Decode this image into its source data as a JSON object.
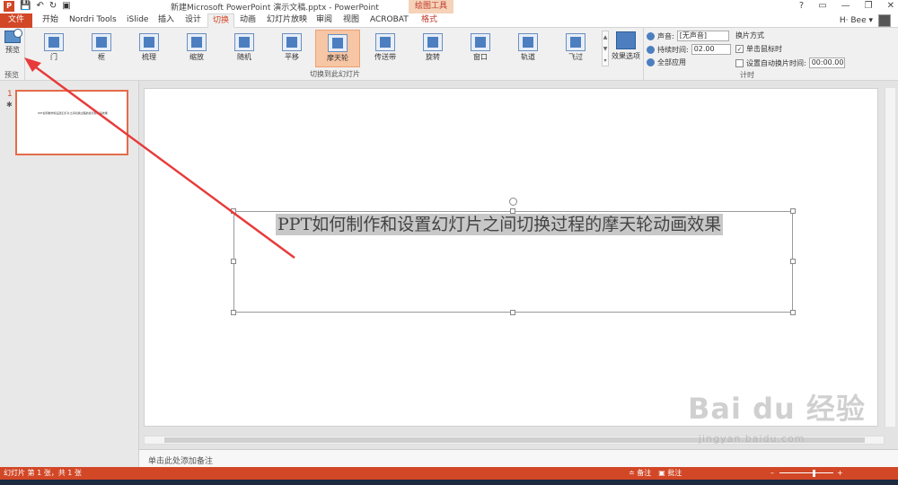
{
  "title_bar": {
    "logo": "P",
    "document_title": "新建Microsoft PowerPoint 演示文稿.pptx - PowerPoint",
    "contextual_group": "绘图工具",
    "help": "?",
    "ribbon_display": "▭",
    "minimize": "—",
    "restore": "❐",
    "close": "✕"
  },
  "tabs": {
    "file": "文件",
    "home": "开始",
    "nordri": "Nordri Tools",
    "islide": "iSlide",
    "insert": "插入",
    "design": "设计",
    "transitions": "切换",
    "animations": "动画",
    "slideshow": "幻灯片放映",
    "review": "审阅",
    "view": "视图",
    "acrobat": "ACROBAT",
    "format": "格式"
  },
  "user": {
    "name": "H· Bee ▾"
  },
  "ribbon": {
    "preview_button": "预览",
    "preview_group": "预览",
    "transition_items": [
      "门",
      "框",
      "梳理",
      "缩放",
      "随机",
      "平移",
      "摩天轮",
      "传送带",
      "旋转",
      "窗口",
      "轨道",
      "飞过"
    ],
    "selected_transition": "摩天轮",
    "gallery_group": "切换到此幻灯片",
    "effect_options": "效果选项",
    "timing": {
      "sound_label": "声音:",
      "sound_value": "[无声音]",
      "duration_label": "持续时间:",
      "duration_value": "02.00",
      "apply_all": "全部应用",
      "advance_title": "换片方式",
      "on_click_label": "单击鼠标时",
      "on_click_checked": true,
      "after_label": "设置自动换片时间:",
      "after_checked": false,
      "after_value": "00:00.00",
      "group_label": "计时"
    }
  },
  "slides_panel": {
    "slide_number": "1",
    "transition_marker": "✱",
    "thumb_text": "PPT如何制作和设置幻灯片之间切换过程的摩天轮动画效果"
  },
  "slide": {
    "title": "PPT如何制作和设置幻灯片之间切换过程的摩天轮动画效果"
  },
  "notes": {
    "placeholder": "单击此处添加备注"
  },
  "status_bar": {
    "slide_info": "幻灯片 第 1 张，共 1 张",
    "notes": "≐ 备注",
    "comments": "▣ 批注",
    "zoom_minus": "–",
    "zoom_plus": "+"
  },
  "watermark": {
    "brand": "Bai du 经验",
    "url": "jingyan.baidu.com"
  },
  "colors": {
    "accent": "#d24726",
    "selected_item": "#f7c6a5",
    "arrow": "#e83a3a"
  }
}
